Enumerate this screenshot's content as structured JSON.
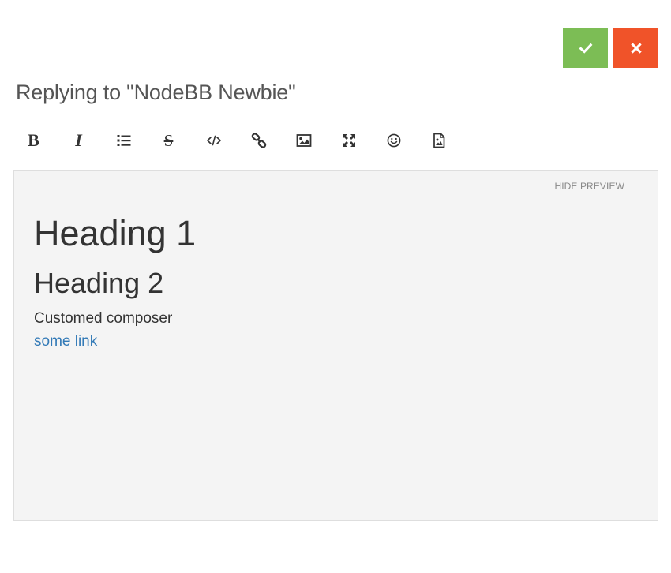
{
  "composer": {
    "title": "Replying to \"NodeBB Newbie\"",
    "actions": {
      "submit_icon": "check-icon",
      "discard_icon": "close-icon",
      "submit_color": "#7cbd55",
      "discard_color": "#f05329"
    },
    "toolbar": [
      {
        "name": "bold",
        "icon": "bold-icon",
        "glyph": "B"
      },
      {
        "name": "italic",
        "icon": "italic-icon",
        "glyph": "I"
      },
      {
        "name": "list",
        "icon": "list-icon"
      },
      {
        "name": "strikethrough",
        "icon": "strikethrough-icon",
        "glyph": "S"
      },
      {
        "name": "code",
        "icon": "code-icon"
      },
      {
        "name": "link",
        "icon": "link-icon"
      },
      {
        "name": "picture",
        "icon": "picture-icon"
      },
      {
        "name": "fullscreen",
        "icon": "expand-icon"
      },
      {
        "name": "emoji",
        "icon": "smiley-icon"
      },
      {
        "name": "upload-image",
        "icon": "file-image-icon"
      }
    ],
    "preview": {
      "hide_label": "HIDE PREVIEW",
      "heading1": "Heading 1",
      "heading2": "Heading 2",
      "paragraph": "Customed composer",
      "link_text": "some link",
      "link_color": "#337ab7"
    }
  }
}
